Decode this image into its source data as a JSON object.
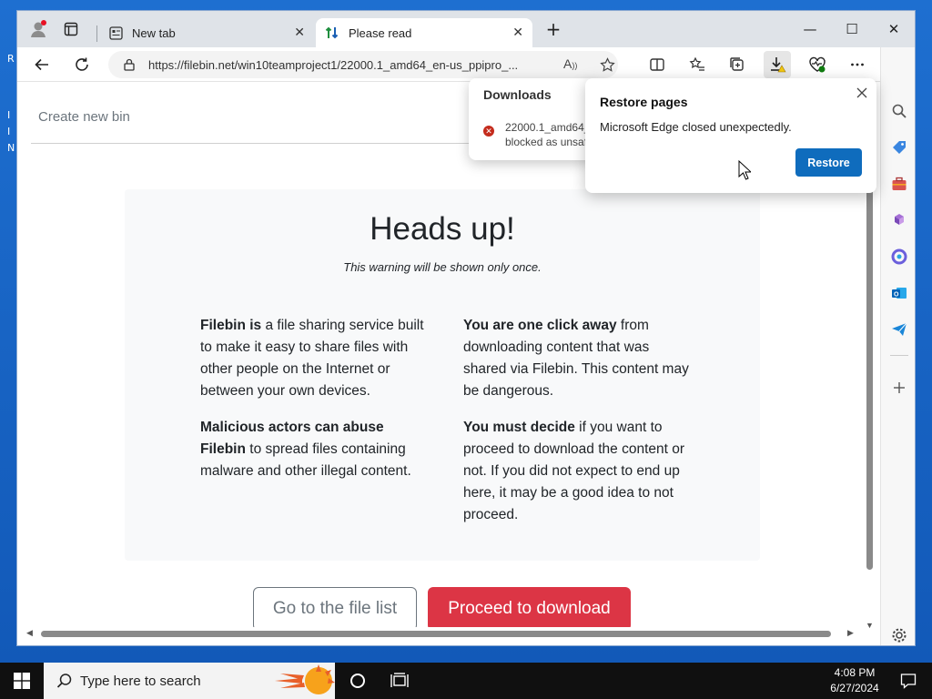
{
  "browser": {
    "tabs": [
      {
        "label": "New tab",
        "active": false
      },
      {
        "label": "Please read",
        "active": true
      }
    ],
    "new_tab_symbol": "+",
    "window_controls": {
      "minimize": "—",
      "maximize": "☐",
      "close": "✕"
    },
    "address": {
      "url": "https://filebin.net/win10teamproject1/22000.1_amd64_en-us_ppipro_..."
    }
  },
  "page": {
    "create_bin": "Create new bin",
    "heading": "Heads up!",
    "subheading": "This warning will be shown only once.",
    "left_col": [
      {
        "bold": "Filebin is",
        "text": " a file sharing service built to make it easy to share files with other people on the Internet or between your own devices."
      },
      {
        "bold": "Malicious actors can abuse Filebin",
        "text": " to spread files containing malware and other illegal content."
      }
    ],
    "right_col": [
      {
        "bold": "You are one click away",
        "text": " from downloading content that was shared via Filebin. This content may be dangerous."
      },
      {
        "bold": "You must decide",
        "text": " if you want to proceed to download the content or not. If you did not expect to end up here, it may be a good idea to not proceed."
      }
    ],
    "btn_file_list": "Go to the file list",
    "btn_proceed": "Proceed to download"
  },
  "downloads": {
    "title": "Downloads",
    "item_line1": "22000.1_amd64_",
    "item_line2": "blocked as unsaf"
  },
  "restore": {
    "title": "Restore pages",
    "message": "Microsoft Edge closed unexpectedly.",
    "button": "Restore"
  },
  "taskbar": {
    "search_placeholder": "Type here to search",
    "time": "4:08 PM",
    "date": "6/27/2024"
  },
  "colors": {
    "accent_blue": "#0f6cbd",
    "danger_red": "#dc3545"
  }
}
